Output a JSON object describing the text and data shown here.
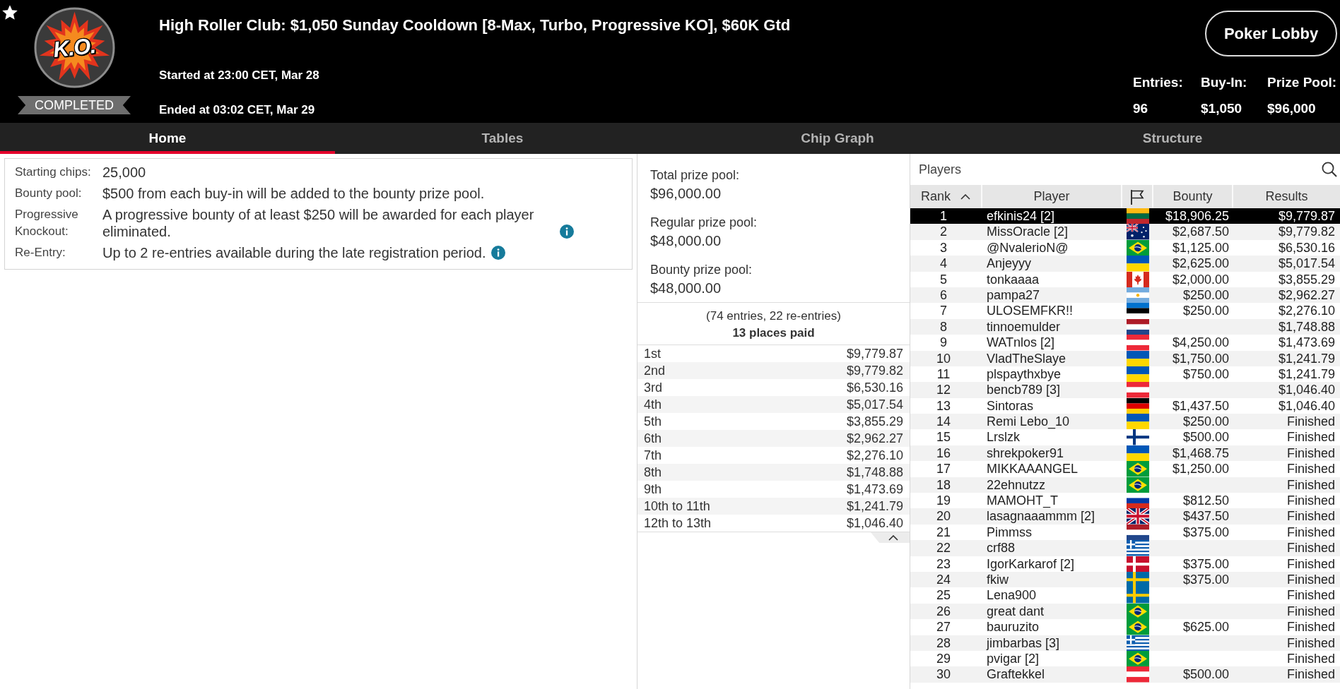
{
  "header": {
    "logo_text": "K.O.",
    "status": "COMPLETED",
    "title": "High Roller Club: $1,050 Sunday Cooldown [8-Max, Turbo, Progressive KO], $60K Gtd",
    "started": "Started at 23:00 CET, Mar 28",
    "ended": "Ended at 03:02 CET, Mar 29",
    "lobby_button": "Poker Lobby",
    "stats": [
      {
        "label": "Entries:",
        "value": "96"
      },
      {
        "label": "Buy-In:",
        "value": "$1,050"
      },
      {
        "label": "Prize Pool:",
        "value": "$96,000"
      }
    ]
  },
  "tabs": [
    {
      "label": "Home",
      "selected": true
    },
    {
      "label": "Tables",
      "selected": false
    },
    {
      "label": "Chip Graph",
      "selected": false
    },
    {
      "label": "Structure",
      "selected": false
    }
  ],
  "details": [
    {
      "label": "Starting chips:",
      "value": "25,000",
      "info": false
    },
    {
      "label": "Bounty pool:",
      "value": "$500 from each buy-in will be added to the bounty prize pool.",
      "info": false
    },
    {
      "label": "Progressive Knockout:",
      "value": "A progressive bounty of at least $250 will be awarded for each player eliminated.",
      "info": true
    },
    {
      "label": "Re-Entry:",
      "value": "Up to 2 re-entries available during the late registration period.",
      "info": true
    }
  ],
  "prize_pools": [
    {
      "label": "Total prize pool:",
      "value": "$96,000.00"
    },
    {
      "label": "Regular prize pool:",
      "value": "$48,000.00"
    },
    {
      "label": "Bounty prize pool:",
      "value": "$48,000.00"
    }
  ],
  "payouts": {
    "entries_note": "(74 entries, 22 re-entries)",
    "places_paid": "13 places paid",
    "expanded": true,
    "rows": [
      {
        "place": "1st",
        "amount": "$9,779.87"
      },
      {
        "place": "2nd",
        "amount": "$9,779.82"
      },
      {
        "place": "3rd",
        "amount": "$6,530.16"
      },
      {
        "place": "4th",
        "amount": "$5,017.54"
      },
      {
        "place": "5th",
        "amount": "$3,855.29"
      },
      {
        "place": "6th",
        "amount": "$2,962.27"
      },
      {
        "place": "7th",
        "amount": "$2,276.10"
      },
      {
        "place": "8th",
        "amount": "$1,748.88"
      },
      {
        "place": "9th",
        "amount": "$1,473.69"
      },
      {
        "place": "10th to 11th",
        "amount": "$1,241.79"
      },
      {
        "place": "12th to 13th",
        "amount": "$1,046.40"
      }
    ]
  },
  "players": {
    "title": "Players",
    "columns": [
      {
        "kind": "text",
        "label": "Rank",
        "sorted": true
      },
      {
        "kind": "text",
        "label": "Player",
        "sorted": false
      },
      {
        "kind": "flag",
        "sorted": false
      },
      {
        "kind": "text",
        "label": "Bounty",
        "sorted": false
      },
      {
        "kind": "text",
        "label": "Results",
        "sorted": false
      }
    ],
    "rows": [
      {
        "rank": "1",
        "player": "efkinis24 [2]",
        "flag": {
          "kind": "lithuania"
        },
        "bounty": "$18,906.25",
        "result": "$9,779.87",
        "selected": true
      },
      {
        "rank": "2",
        "player": "MissOracle [2]",
        "flag": {
          "kind": "australia"
        },
        "bounty": "$2,687.50",
        "result": "$9,779.82",
        "selected": false
      },
      {
        "rank": "3",
        "player": "@NvalerioN@",
        "flag": {
          "kind": "brazil"
        },
        "bounty": "$1,125.00",
        "result": "$6,530.16",
        "selected": false
      },
      {
        "rank": "4",
        "player": "Anjeyyy",
        "flag": {
          "kind": "ukraine"
        },
        "bounty": "$2,625.00",
        "result": "$5,017.54",
        "selected": false
      },
      {
        "rank": "5",
        "player": "tonkaaaa",
        "flag": {
          "kind": "canada"
        },
        "bounty": "$2,000.00",
        "result": "$3,855.29",
        "selected": false
      },
      {
        "rank": "6",
        "player": "pampa27",
        "flag": {
          "kind": "argentina"
        },
        "bounty": "$250.00",
        "result": "$2,962.27",
        "selected": false
      },
      {
        "rank": "7",
        "player": "ULOSEMFKR!!",
        "flag": {
          "kind": "estonia"
        },
        "bounty": "$250.00",
        "result": "$2,276.10",
        "selected": false
      },
      {
        "rank": "8",
        "player": "tinnoemulder",
        "flag": {
          "kind": "netherlands"
        },
        "result": "$1,748.88",
        "selected": false
      },
      {
        "rank": "9",
        "player": "WATnlos [2]",
        "flag": {
          "kind": "austria"
        },
        "bounty": "$4,250.00",
        "result": "$1,473.69",
        "selected": false
      },
      {
        "rank": "10",
        "player": "VladTheSlaye",
        "flag": {
          "kind": "ukraine"
        },
        "bounty": "$1,750.00",
        "result": "$1,241.79",
        "selected": false
      },
      {
        "rank": "11",
        "player": "plspaythxbye",
        "flag": {
          "kind": "ukraine"
        },
        "bounty": "$750.00",
        "result": "$1,241.79",
        "selected": false
      },
      {
        "rank": "12",
        "player": "bencb789 [3]",
        "flag": {
          "kind": "austria"
        },
        "result": "$1,046.40",
        "selected": false
      },
      {
        "rank": "13",
        "player": "Sintoras",
        "flag": {
          "kind": "germany"
        },
        "bounty": "$1,437.50",
        "result": "$1,046.40",
        "selected": false
      },
      {
        "rank": "14",
        "player": "Remi Lebo_10",
        "flag": {
          "kind": "ukraine"
        },
        "bounty": "$250.00",
        "result": "Finished",
        "selected": false
      },
      {
        "rank": "15",
        "player": "Lrslzk",
        "flag": {
          "kind": "finland"
        },
        "bounty": "$500.00",
        "result": "Finished",
        "selected": false
      },
      {
        "rank": "16",
        "player": "shrekpoker91",
        "flag": {
          "kind": "ukraine"
        },
        "bounty": "$1,468.75",
        "result": "Finished",
        "selected": false
      },
      {
        "rank": "17",
        "player": "MIKKAAANGEL",
        "flag": {
          "kind": "brazil"
        },
        "bounty": "$1,250.00",
        "result": "Finished",
        "selected": false
      },
      {
        "rank": "18",
        "player": "22ehnutzz",
        "flag": {
          "kind": "brazil"
        },
        "result": "Finished",
        "selected": false
      },
      {
        "rank": "19",
        "player": "MAMOHT_T",
        "flag": {
          "kind": "russia"
        },
        "bounty": "$812.50",
        "result": "Finished",
        "selected": false
      },
      {
        "rank": "20",
        "player": "lasagnaaammm [2]",
        "flag": {
          "kind": "united-kingdom"
        },
        "bounty": "$437.50",
        "result": "Finished",
        "selected": false
      },
      {
        "rank": "21",
        "player": "Pimmss",
        "flag": {
          "kind": "netherlands"
        },
        "bounty": "$375.00",
        "result": "Finished",
        "selected": false
      },
      {
        "rank": "22",
        "player": "crf88",
        "flag": {
          "kind": "greece"
        },
        "result": "Finished",
        "selected": false
      },
      {
        "rank": "23",
        "player": "IgorKarkarof [2]",
        "flag": {
          "kind": "denmark"
        },
        "bounty": "$375.00",
        "result": "Finished",
        "selected": false
      },
      {
        "rank": "24",
        "player": "fkiw",
        "flag": {
          "kind": "sweden"
        },
        "bounty": "$375.00",
        "result": "Finished",
        "selected": false
      },
      {
        "rank": "25",
        "player": "Lena900",
        "flag": {
          "kind": "sweden"
        },
        "result": "Finished",
        "selected": false
      },
      {
        "rank": "26",
        "player": "great dant",
        "flag": {
          "kind": "brazil"
        },
        "result": "Finished",
        "selected": false
      },
      {
        "rank": "27",
        "player": "bauruzito",
        "flag": {
          "kind": "brazil"
        },
        "bounty": "$625.00",
        "result": "Finished",
        "selected": false
      },
      {
        "rank": "28",
        "player": "jimbarbas [3]",
        "flag": {
          "kind": "greece"
        },
        "result": "Finished",
        "selected": false
      },
      {
        "rank": "29",
        "player": "pvigar [2]",
        "flag": {
          "kind": "brazil"
        },
        "result": "Finished",
        "selected": false
      },
      {
        "rank": "30",
        "player": "Graftekkel",
        "flag": {
          "kind": "austria"
        },
        "bounty": "$500.00",
        "result": "Finished",
        "selected": false
      }
    ]
  }
}
